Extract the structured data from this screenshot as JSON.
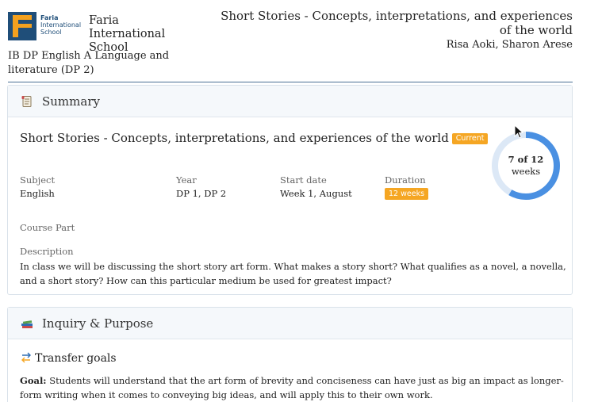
{
  "header": {
    "logo_line1": "Faria",
    "logo_line2": "International",
    "logo_line3": "School",
    "school_name": "Faria International School",
    "course": "IB DP English A Language and literature (DP 2)",
    "unit_title": "Short Stories - Concepts, interpretations, and experiences of the world",
    "authors": "Risa Aoki, Sharon Arese"
  },
  "summary": {
    "heading": "Summary",
    "icon": "scroll-icon",
    "unit_title": "Short Stories - Concepts, interpretations, and experiences of the world",
    "status_badge": "Current",
    "subject_label": "Subject",
    "subject_value": "English",
    "year_label": "Year",
    "year_value": "DP 1, DP 2",
    "start_label": "Start date",
    "start_value": "Week 1, August",
    "duration_label": "Duration",
    "duration_value": "12 weeks",
    "course_part_label": "Course Part",
    "description_label": "Description",
    "description": "In class we will be discussing the short story art form. What makes a story short? What qualifies as a novel, a novella, and a short story? How can this particular medium be used for greatest impact?",
    "progress": {
      "current": 7,
      "total": 12,
      "fraction": 0.5833,
      "line1": "7 of 12",
      "line2": "weeks",
      "color": "#4a90e2",
      "track_color": "#dce8f6"
    }
  },
  "inquiry": {
    "heading": "Inquiry & Purpose",
    "icon": "books-icon",
    "transfer_heading": "Transfer goals",
    "transfer_icon": "transfer-arrows-icon",
    "goal_label": "Goal:",
    "goal_text": " Students will understand that the art form of brevity and conciseness can have just as big an impact as longer-form writing when it comes to conveying big ideas, and will apply this to their own work."
  },
  "colors": {
    "badge": "#f5a623",
    "brand": "#1f4e79",
    "accent": "#4a90e2"
  }
}
